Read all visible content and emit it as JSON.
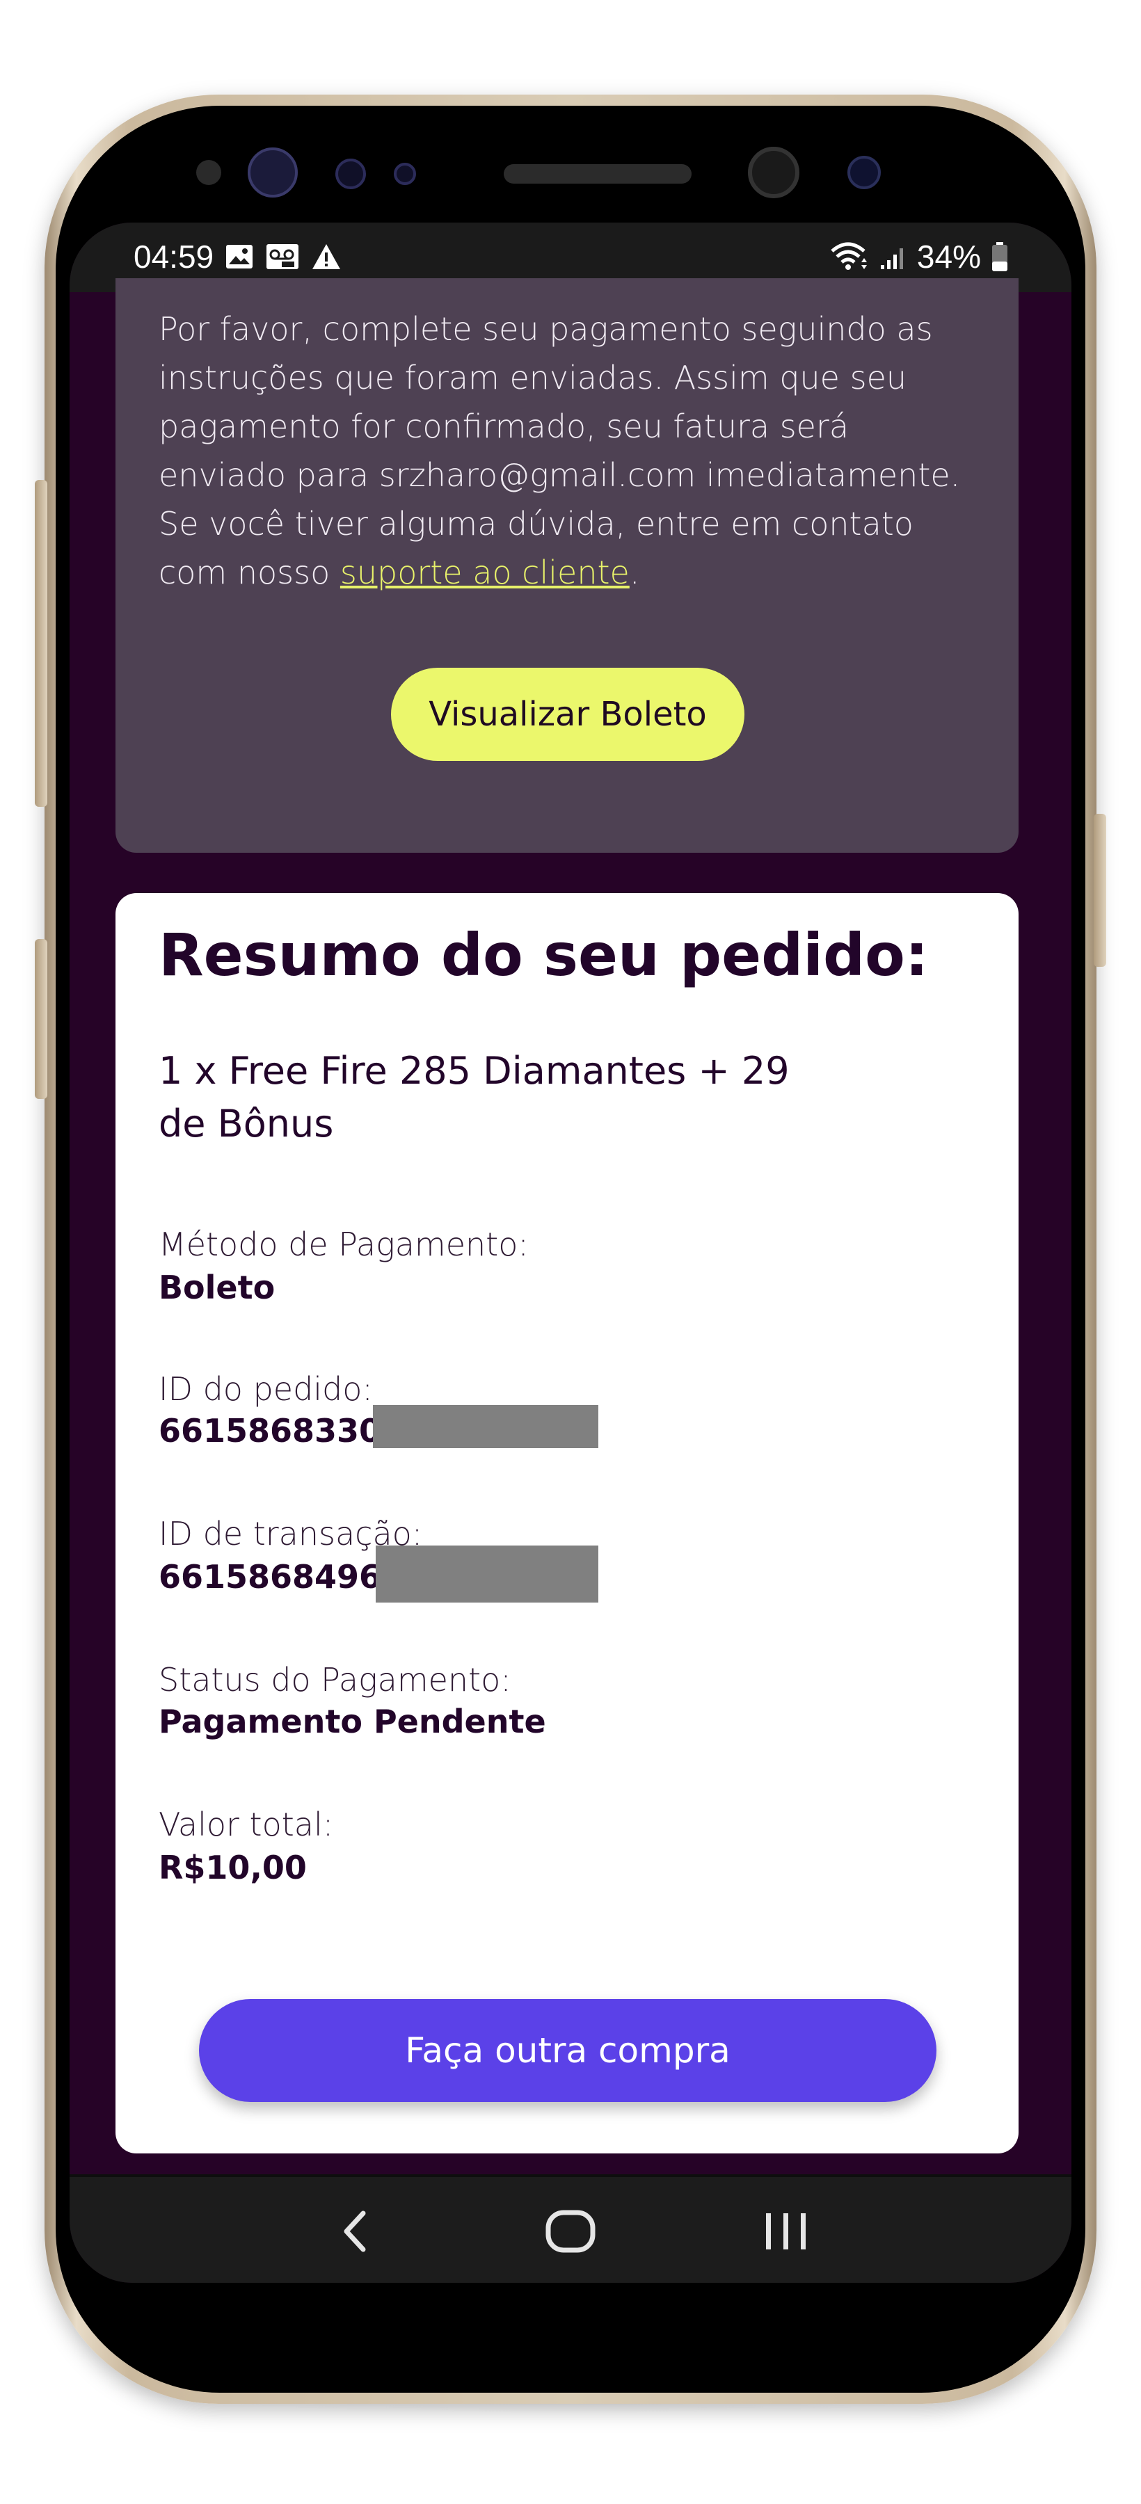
{
  "status_bar": {
    "time": "04:59",
    "left_icons": [
      "image-icon",
      "voicemail-icon",
      "warning-icon"
    ],
    "right_icons": [
      "wifi-icon",
      "signal-icon",
      "battery-icon"
    ],
    "battery": "34%"
  },
  "payment_info": {
    "text_before_link": "Por favor, complete seu pagamento seguindo as instruções que foram enviadas. Assim que seu pagamento for confirmado, seu fatura será enviado para srzharo@gmail.com imediatamente. Se você tiver alguma dúvida, entre em contato com nosso ",
    "link_text": "suporte ao cliente",
    "text_after_link": ".",
    "button_label": "Visualizar Boleto"
  },
  "order_summary": {
    "title": "Resumo do seu pedido:",
    "product": "1 x Free Fire 285 Diamantes + 29 de Bônus",
    "fields": [
      {
        "label": "Método de Pagamento:",
        "value": "Boleto"
      },
      {
        "label": "ID do pedido:",
        "value": "6615868330"
      },
      {
        "label": "ID de transação:",
        "value": "6615868496"
      },
      {
        "label": "Status do Pagamento:",
        "value": "Pagamento Pendente"
      },
      {
        "label": "Valor total:",
        "value": "R$10,00"
      }
    ],
    "button_label": "Faça outra compra"
  },
  "navigation": {
    "buttons": [
      "back-icon",
      "home-icon",
      "recent-apps-icon"
    ]
  },
  "colors": {
    "page_background": "#260327",
    "info_card": "#4e4153",
    "boleto_button": "#ebf76c",
    "primary_button": "#5b41e8",
    "link": "#e8f26a"
  }
}
